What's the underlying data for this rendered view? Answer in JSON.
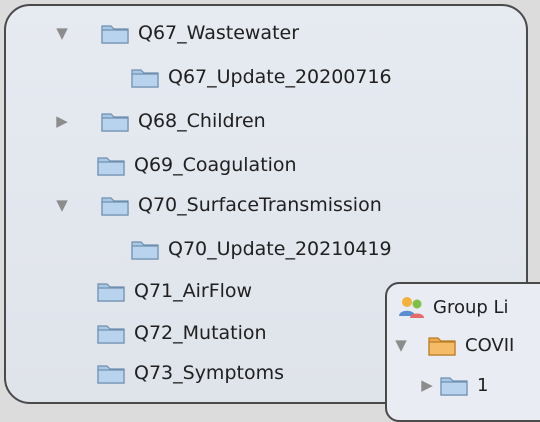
{
  "tree": {
    "items": [
      {
        "label": "Q67_Wastewater",
        "state": "expanded"
      },
      {
        "label": "Q67_Update_20200716",
        "state": "none"
      },
      {
        "label": "Q68_Children",
        "state": "collapsed"
      },
      {
        "label": "Q69_Coagulation",
        "state": "none"
      },
      {
        "label": "Q70_SurfaceTransmission",
        "state": "expanded"
      },
      {
        "label": "Q70_Update_20210419",
        "state": "none"
      },
      {
        "label": "Q71_AirFlow",
        "state": "none"
      },
      {
        "label": "Q72_Mutation",
        "state": "none"
      },
      {
        "label": "Q73_Symptoms",
        "state": "none"
      }
    ]
  },
  "overlay": {
    "header_label": "Group Li",
    "group_label": "COVII",
    "child_label": "1"
  },
  "colors": {
    "folder_blue": "#a9c8e6",
    "folder_orange": "#f0a94a",
    "disclosure_gray": "#8c8c8c"
  },
  "icons": {
    "expanded": "disclosure-expanded-icon",
    "collapsed": "disclosure-collapsed-icon",
    "folder": "folder-icon",
    "group": "group-list-icon"
  }
}
